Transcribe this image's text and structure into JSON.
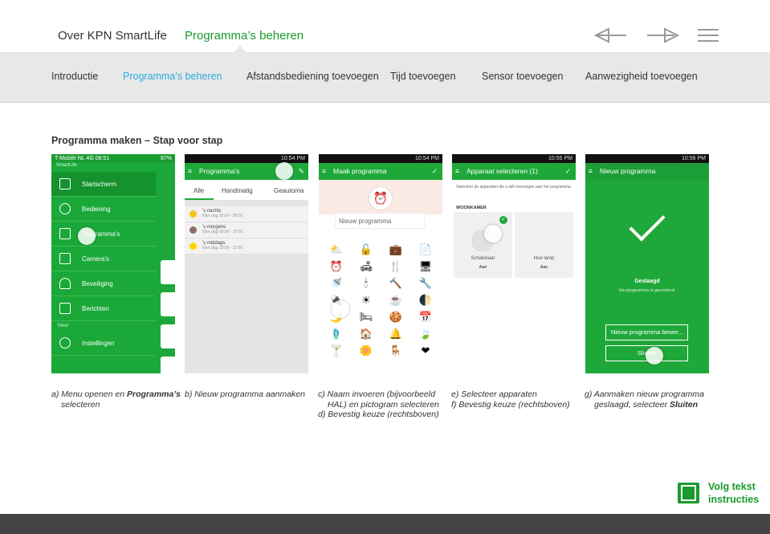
{
  "header": {
    "tabs": [
      {
        "label": "Over KPN SmartLife",
        "active": false
      },
      {
        "label": "Programma’s beheren",
        "active": true
      }
    ],
    "nav_icons": [
      "arrow-left-icon",
      "arrow-right-icon",
      "hamburger-menu-icon"
    ]
  },
  "subnav": {
    "items": [
      {
        "label": "Introductie",
        "active": false
      },
      {
        "label": "Programma’s beheren",
        "active": true
      },
      {
        "label": "Afstandsbediening toevoegen",
        "active": false
      },
      {
        "label": "Tijd toevoegen",
        "active": false
      },
      {
        "label": "Sensor toevoegen",
        "active": false
      },
      {
        "label": "Aanwezigheid toevoegen",
        "active": false
      }
    ]
  },
  "section_title": "Programma maken – Stap voor stap",
  "phones": {
    "p1": {
      "carrier": "T-Mobile NL  4G  08:51",
      "battery": "87%",
      "app": "SmartLife",
      "menu": [
        "Startscherm",
        "Bediening",
        "Programma's",
        "Camera's",
        "Beveiliging",
        "Berichten"
      ],
      "more": "Meer",
      "settings": "Instellingen"
    },
    "p2": {
      "time": "10:54 PM",
      "title": "Programma's",
      "tabs": [
        "Alle",
        "Handmatig",
        "Geautoma"
      ],
      "programs": [
        {
          "title": "'s nachts",
          "sub": "Elke dag 00:00 - 08:00"
        },
        {
          "title": "'s morgens",
          "sub": "Elke dag 08:00 - 10:00"
        },
        {
          "title": "'s middags",
          "sub": "Elke dag 10:00 - 12:00"
        }
      ]
    },
    "p3": {
      "time": "10:54 PM",
      "title": "Maak programma",
      "placeholder": "Nieuw programma",
      "icons": [
        "⛅",
        "🔓",
        "💼",
        "📄",
        "⏰",
        "🛋",
        "🍴",
        "🖥",
        "🚿",
        "🕯",
        "🔨",
        "🔧",
        "🔌",
        "☀",
        "☕",
        "🌓",
        "🌙",
        "🛏",
        "🍪",
        "📅",
        "🩴",
        "🏠",
        "🔔",
        "🍃",
        "🍸",
        "🌼",
        "🪑",
        "❤"
      ]
    },
    "p4": {
      "time": "10:55 PM",
      "title": "Apparaat selecteren (1)",
      "instruction": "Selecteer de apparaten die u wilt toevoegen aan het programma.",
      "room": "WOONKAMER",
      "devices": [
        {
          "name": "Schakelaar",
          "state": "Aan"
        },
        {
          "name": "Hue lamp",
          "state": "Aan"
        }
      ]
    },
    "p5": {
      "time": "10:56 PM",
      "title": "Nieuw programma",
      "success": "Geslaagd",
      "success_sub": "Uw programma is gecreëerd.",
      "field": "Nieuw programma bewer...",
      "close": "Sluiten"
    }
  },
  "captions": [
    {
      "line1": "a) Menu openen en ",
      "bold1": "Programma’s",
      "line2": "selecteren"
    },
    {
      "line1": "b) Nieuw programma aanmaken"
    },
    {
      "line1": "c) Naam invoeren (bijvoorbeeld",
      "line2": "HAL) en pictogram selecteren",
      "line3": "d) Bevestig keuze (rechtsboven)"
    },
    {
      "line1": "e) Selecteer apparaten",
      "line2": "f) Bevestig keuze (rechtsboven)"
    },
    {
      "line1": "g) Aanmaken nieuw programma",
      "line2": "geslaagd, selecteer ",
      "bold2": "Sluiten"
    }
  ],
  "follow": {
    "line1": "Volg tekst",
    "line2": "instructies"
  },
  "colors": {
    "brand_green": "#1a9b2e",
    "active_blue": "#2eaadc",
    "subnav_bg": "#e8e8e8",
    "footer": "#444444"
  }
}
